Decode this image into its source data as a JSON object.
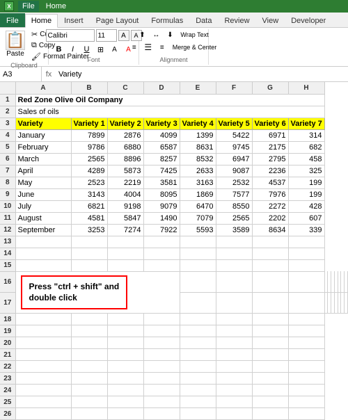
{
  "titlebar": {
    "label": "File"
  },
  "ribbon": {
    "tabs": [
      "File",
      "Home",
      "Insert",
      "Page Layout",
      "Formulas",
      "Data",
      "Review",
      "View",
      "Developer"
    ],
    "active_tab": "Home",
    "clipboard": {
      "label": "Clipboard",
      "paste": "Paste",
      "cut": "Cut",
      "copy": "Copy",
      "format_painter": "Format Painter"
    },
    "font": {
      "label": "Font",
      "family": "Calibri",
      "size": "11",
      "bold": "B",
      "italic": "I",
      "underline": "U"
    },
    "alignment": {
      "label": "Alignment",
      "wrap_text": "Wrap Text",
      "merge_center": "Merge & Center"
    }
  },
  "formula_bar": {
    "cell_ref": "A3",
    "fx": "fx",
    "formula": "Variety"
  },
  "sheet": {
    "columns": [
      "",
      "A",
      "B",
      "C",
      "D",
      "E",
      "F",
      "G",
      "H"
    ],
    "col_labels": [
      "Variety",
      "Variety 1",
      "Variety 2",
      "Variety 3",
      "Variety 4",
      "Variety 5",
      "Variety 6",
      "Variety 7"
    ],
    "rows": [
      {
        "num": 1,
        "cells": [
          "Red Zone Olive Oil Company",
          "",
          "",
          "",
          "",
          "",
          "",
          ""
        ]
      },
      {
        "num": 2,
        "cells": [
          "Sales of oils",
          "",
          "",
          "",
          "",
          "",
          "",
          ""
        ]
      },
      {
        "num": 3,
        "cells": [
          "Variety",
          "Variety 1",
          "Variety 2",
          "Variety 3",
          "Variety 4",
          "Variety 5",
          "Variety 6",
          "Variety 7"
        ]
      },
      {
        "num": 4,
        "cells": [
          "January",
          "7899",
          "2876",
          "4099",
          "1399",
          "5422",
          "6971",
          "314"
        ]
      },
      {
        "num": 5,
        "cells": [
          "February",
          "9786",
          "6880",
          "6587",
          "8631",
          "9745",
          "2175",
          "682"
        ]
      },
      {
        "num": 6,
        "cells": [
          "March",
          "2565",
          "8896",
          "8257",
          "8532",
          "6947",
          "2795",
          "458"
        ]
      },
      {
        "num": 7,
        "cells": [
          "April",
          "4289",
          "5873",
          "7425",
          "2633",
          "9087",
          "2236",
          "325"
        ]
      },
      {
        "num": 8,
        "cells": [
          "May",
          "2523",
          "2219",
          "3581",
          "3163",
          "2532",
          "4537",
          "199"
        ]
      },
      {
        "num": 9,
        "cells": [
          "June",
          "3143",
          "4004",
          "8095",
          "1869",
          "7577",
          "7976",
          "199"
        ]
      },
      {
        "num": 10,
        "cells": [
          "July",
          "6821",
          "9198",
          "9079",
          "6470",
          "8550",
          "2272",
          "428"
        ]
      },
      {
        "num": 11,
        "cells": [
          "August",
          "4581",
          "5847",
          "1490",
          "7079",
          "2565",
          "2202",
          "607"
        ]
      },
      {
        "num": 12,
        "cells": [
          "September",
          "3253",
          "7274",
          "7922",
          "5593",
          "3589",
          "8634",
          "339"
        ]
      },
      {
        "num": 13,
        "cells": [
          "",
          "",
          "",
          "",
          "",
          "",
          "",
          ""
        ]
      },
      {
        "num": 14,
        "cells": [
          "",
          "",
          "",
          "",
          "",
          "",
          "",
          ""
        ]
      },
      {
        "num": 15,
        "cells": [
          "",
          "",
          "",
          "",
          "",
          "",
          "",
          ""
        ]
      },
      {
        "num": 16,
        "cells": [
          "",
          "",
          "",
          "",
          "",
          "",
          "",
          ""
        ]
      },
      {
        "num": 17,
        "cells": [
          "",
          "",
          "",
          "",
          "",
          "",
          "",
          ""
        ]
      },
      {
        "num": 18,
        "cells": [
          "",
          "",
          "",
          "",
          "",
          "",
          "",
          ""
        ]
      },
      {
        "num": 19,
        "cells": [
          "",
          "",
          "",
          "",
          "",
          "",
          "",
          ""
        ]
      },
      {
        "num": 20,
        "cells": [
          "",
          "",
          "",
          "",
          "",
          "",
          "",
          ""
        ]
      },
      {
        "num": 21,
        "cells": [
          "",
          "",
          "",
          "",
          "",
          "",
          "",
          ""
        ]
      },
      {
        "num": 22,
        "cells": [
          "",
          "",
          "",
          "",
          "",
          "",
          "",
          ""
        ]
      },
      {
        "num": 23,
        "cells": [
          "",
          "",
          "",
          "",
          "",
          "",
          "",
          ""
        ]
      },
      {
        "num": 24,
        "cells": [
          "",
          "",
          "",
          "",
          "",
          "",
          "",
          ""
        ]
      },
      {
        "num": 25,
        "cells": [
          "",
          "",
          "",
          "",
          "",
          "",
          "",
          ""
        ]
      },
      {
        "num": 26,
        "cells": [
          "",
          "",
          "",
          "",
          "",
          "",
          "",
          ""
        ]
      }
    ],
    "instruction": {
      "line1": "Press \"ctrl + shift\" and",
      "line2": "double click"
    }
  }
}
